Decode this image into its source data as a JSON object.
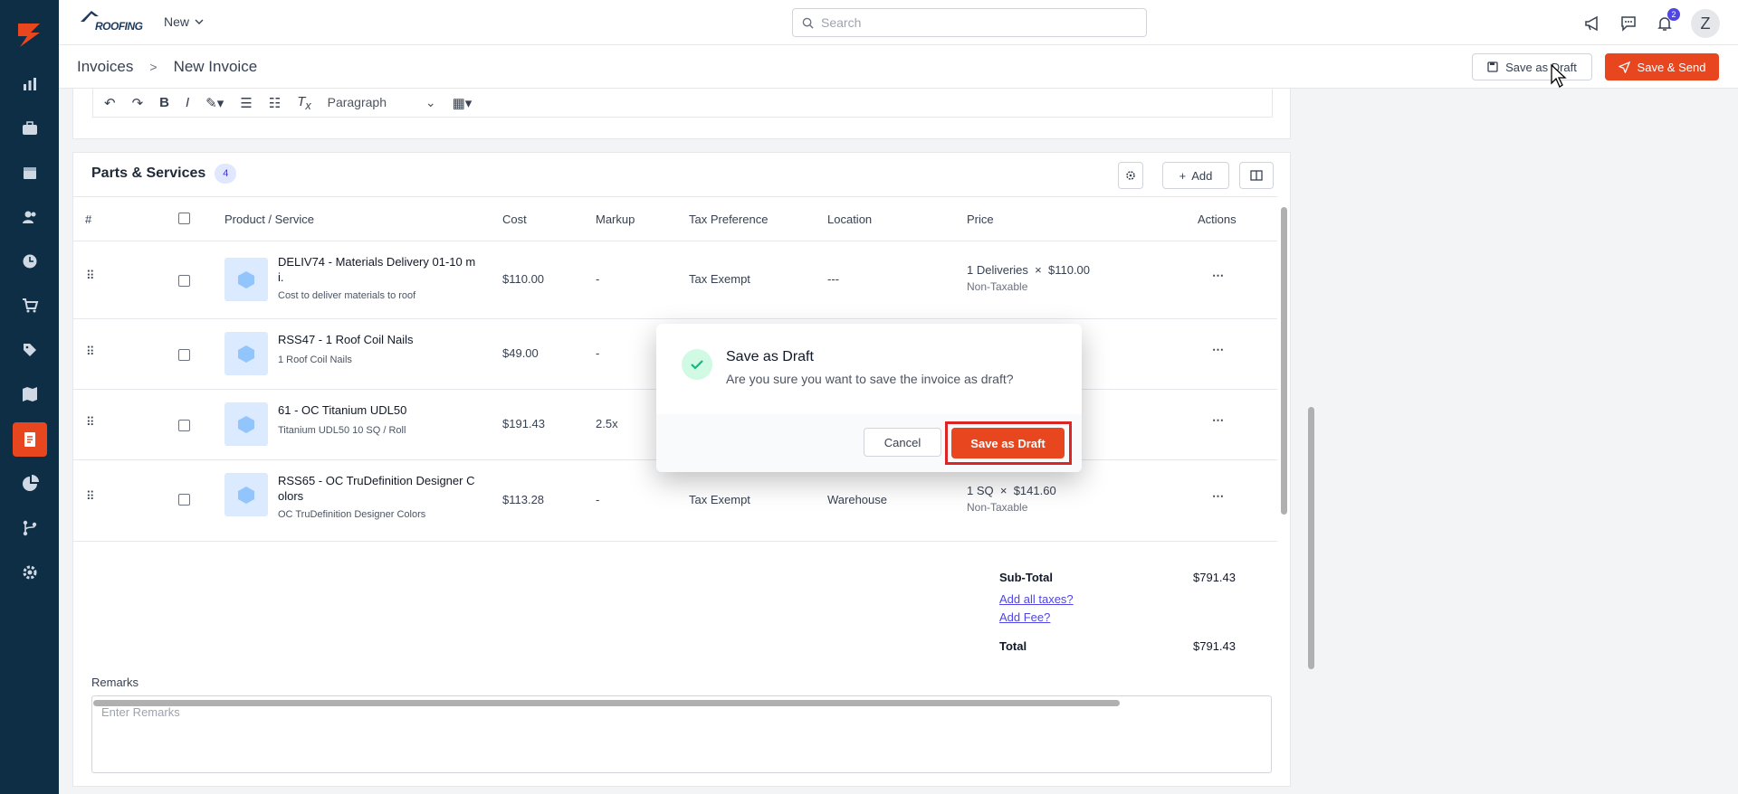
{
  "app": {
    "brand_text": "ROOFING",
    "new_label": "New",
    "search_placeholder": "Search",
    "notification_count": "2",
    "avatar_initial": "Z"
  },
  "colors": {
    "accent": "#e8461e",
    "sidebar": "#0d2e45",
    "link": "#4f46e5"
  },
  "sidebar": {
    "items": [
      {
        "icon": "dashboard-chart-icon"
      },
      {
        "icon": "jobs-briefcase-icon"
      },
      {
        "icon": "calendar-icon"
      },
      {
        "icon": "contacts-users-icon"
      },
      {
        "icon": "timesheet-clock-icon"
      },
      {
        "icon": "cart-icon"
      },
      {
        "icon": "tag-icon"
      },
      {
        "icon": "map-icon"
      },
      {
        "icon": "invoice-document-icon",
        "active": true
      },
      {
        "icon": "reports-pie-icon"
      },
      {
        "icon": "workflow-icon"
      },
      {
        "icon": "settings-gear-icon"
      }
    ]
  },
  "breadcrumb": {
    "parent": "Invoices",
    "separator": ">",
    "current": "New Invoice"
  },
  "header_actions": {
    "save_draft": "Save as Draft",
    "save_send": "Save & Send"
  },
  "editor": {
    "paragraph_label": "Paragraph"
  },
  "parts": {
    "title": "Parts & Services",
    "count": "4",
    "add_label": "Add",
    "columns": [
      "#",
      "Product / Service",
      "Cost",
      "Markup",
      "Tax Preference",
      "Location",
      "Price",
      "Actions"
    ],
    "rows": [
      {
        "name_line1": "DELIV74 - Materials Delivery 01-10 m",
        "name_line2": "i.",
        "desc": "Cost to deliver materials to roof",
        "cost": "$110.00",
        "markup": "-",
        "tax": "Tax Exempt",
        "location": "---",
        "qty": "1 Deliveries",
        "times": "×",
        "unit_price": "$110.00",
        "taxable": "Non-Taxable"
      },
      {
        "name_line1": "RSS47 - 1 Roof Coil Nails",
        "name_line2": "",
        "desc": "1 Roof Coil Nails",
        "cost": "$49.00",
        "markup": "-",
        "tax": "",
        "location": "",
        "qty": "",
        "times": "",
        "unit_price": "",
        "taxable": ""
      },
      {
        "name_line1": "61 - OC Titanium UDL50",
        "name_line2": "",
        "desc": "Titanium UDL50 10 SQ / Roll",
        "cost": "$191.43",
        "markup": "2.5x",
        "tax": "",
        "location": "",
        "qty": "",
        "times": "",
        "unit_price": "",
        "taxable": ""
      },
      {
        "name_line1": "RSS65 - OC TruDefinition Designer C",
        "name_line2": "olors",
        "desc": "OC TruDefinition Designer Colors",
        "cost": "$113.28",
        "markup": "-",
        "tax": "Tax Exempt",
        "location": "Warehouse",
        "qty": "1 SQ",
        "times": "×",
        "unit_price": "$141.60",
        "taxable": "Non-Taxable"
      }
    ]
  },
  "totals": {
    "subtotal_label": "Sub-Total",
    "subtotal": "$791.43",
    "add_taxes": "Add all taxes?",
    "add_fee": "Add Fee?",
    "total_label": "Total",
    "total": "$791.43"
  },
  "remarks": {
    "label": "Remarks",
    "placeholder": "Enter Remarks"
  },
  "modal": {
    "title": "Save as Draft",
    "message": "Are you sure you want to save the invoice as draft?",
    "cancel": "Cancel",
    "confirm": "Save as Draft"
  }
}
